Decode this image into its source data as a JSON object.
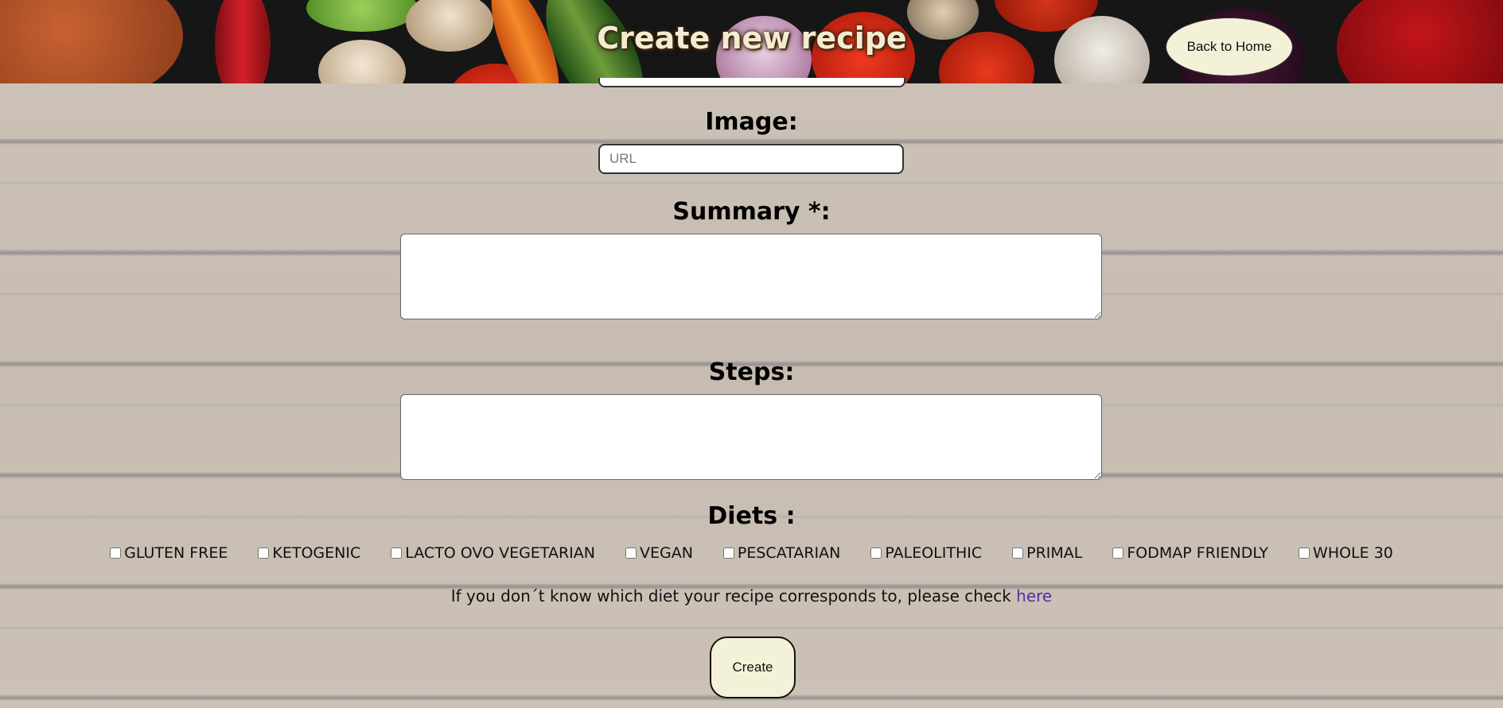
{
  "header": {
    "title": "Create new recipe",
    "back_label": "Back to Home"
  },
  "form": {
    "image_label": "Image:",
    "image_placeholder": "URL",
    "summary_label": "Summary *:",
    "steps_label": "Steps:",
    "diets_label": "Diets :",
    "diets": [
      "GLUTEN FREE",
      "KETOGENIC",
      "LACTO OVO VEGETARIAN",
      "VEGAN",
      "PESCATARIAN",
      "PALEOLITHIC",
      "PRIMAL",
      "FODMAP FRIENDLY",
      "WHOLE 30"
    ],
    "help_text": "If you don´t know which diet your recipe corresponds to, please check ",
    "help_link": "here",
    "create_label": "Create"
  }
}
